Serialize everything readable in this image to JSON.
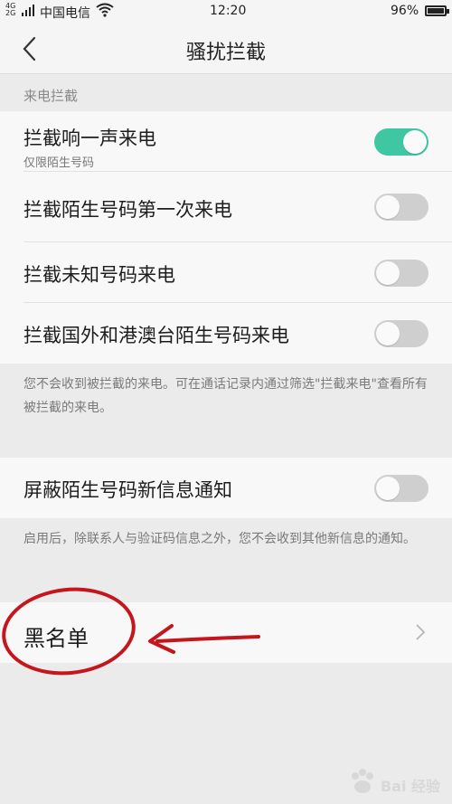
{
  "status_bar": {
    "network_top": "4G",
    "network_bottom": "2G",
    "carrier": "中国电信",
    "time": "12:20",
    "battery": "96%"
  },
  "header": {
    "title": "骚扰拦截",
    "back_icon": "chevron-left-icon"
  },
  "call_section": {
    "title": "来电拦截",
    "items": [
      {
        "label": "拦截响一声来电",
        "subtitle": "仅限陌生号码",
        "enabled": true
      },
      {
        "label": "拦截陌生号码第一次来电",
        "enabled": false
      },
      {
        "label": "拦截未知号码来电",
        "enabled": false
      },
      {
        "label": "拦截国外和港澳台陌生号码来电",
        "enabled": false
      }
    ],
    "note": "您不会收到被拦截的来电。可在通话记录内通过筛选\"拦截来电\"查看所有被拦截的来电。"
  },
  "message_section": {
    "item": {
      "label": "屏蔽陌生号码新信息通知",
      "enabled": false
    },
    "note": "启用后，除联系人与验证码信息之外，您不会收到其他新信息的通知。"
  },
  "blacklist": {
    "label": "黑名单",
    "icon": "chevron-right-icon"
  },
  "annotation": {
    "color": "#c4161c",
    "shapes": [
      "red-circle",
      "red-arrow"
    ]
  },
  "watermark": {
    "text": "Bai 经验",
    "icon": "paw-icon"
  },
  "colors": {
    "toggle_on": "#3fc6a3",
    "toggle_off": "#cfcfcf",
    "background": "#ebebeb",
    "card": "#f8f8f8"
  }
}
